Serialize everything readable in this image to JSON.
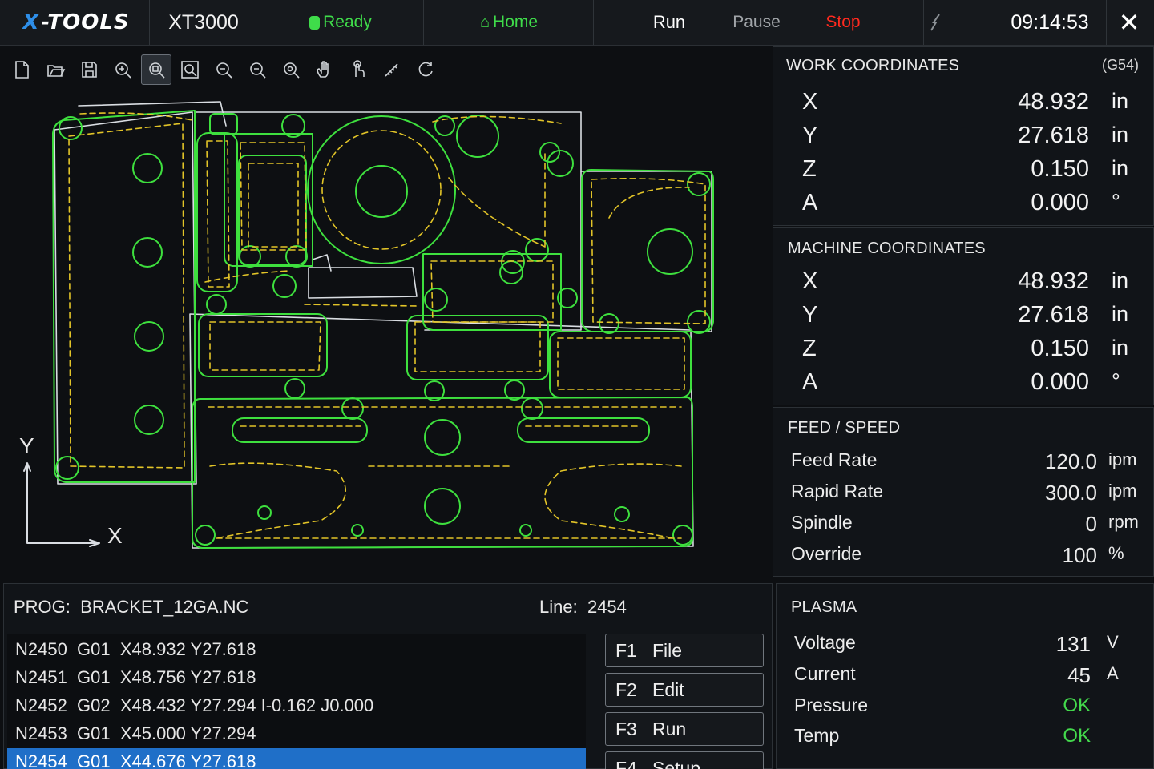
{
  "topbar": {
    "logo_x": "X",
    "logo_rest": "-TOOLS",
    "model": "XT3000",
    "status": "Ready",
    "home": "Home",
    "run": "Run",
    "pause": "Pause",
    "stop": "Stop",
    "time": "09:14:53",
    "close": "✕",
    "signal_icon": "signal-icon"
  },
  "toolbar": {
    "tools": [
      "new-file-icon",
      "open-file-icon",
      "save-file-icon",
      "zoom-in-icon",
      "zoom-window-icon",
      "zoom-fit-icon",
      "zoom-extents-icon",
      "zoom-out-icon",
      "zoom-select-icon",
      "pan-hand-icon",
      "touch-icon",
      "measure-icon",
      "reset-view-icon"
    ],
    "active_index": 4
  },
  "canvas": {
    "axis_y": "Y",
    "axis_x": "X",
    "colors": {
      "part": "#3ee03e",
      "toolpath": "#e2c428",
      "outline": "#d9dde2"
    }
  },
  "work": {
    "title": "WORK COORDINATES",
    "offset": "(G54)",
    "rows": [
      {
        "axis": "X",
        "value": "48.932",
        "unit": "in"
      },
      {
        "axis": "Y",
        "value": "27.618",
        "unit": "in"
      },
      {
        "axis": "Z",
        "value": "0.150",
        "unit": "in"
      },
      {
        "axis": "A",
        "value": "0.000",
        "unit": "°"
      }
    ]
  },
  "machine": {
    "title": "MACHINE COORDINATES",
    "rows": [
      {
        "axis": "X",
        "value": "48.932",
        "unit": "in"
      },
      {
        "axis": "Y",
        "value": "27.618",
        "unit": "in"
      },
      {
        "axis": "Z",
        "value": "0.150",
        "unit": "in"
      },
      {
        "axis": "A",
        "value": "0.000",
        "unit": "°"
      }
    ]
  },
  "feed": {
    "title": "FEED / SPEED",
    "rows": [
      {
        "label": "Feed Rate",
        "value": "120.0",
        "unit": "ipm"
      },
      {
        "label": "Rapid Rate",
        "value": "300.0",
        "unit": "ipm"
      },
      {
        "label": "Spindle",
        "value": "0",
        "unit": "rpm"
      },
      {
        "label": "Override",
        "value": "100",
        "unit": "%"
      }
    ]
  },
  "plasma": {
    "title": "PLASMA",
    "rows": [
      {
        "label": "Voltage",
        "value": "131",
        "unit": "V"
      },
      {
        "label": "Current",
        "value": "45",
        "unit": "A"
      },
      {
        "label": "Pressure",
        "value": "OK",
        "unit": ""
      },
      {
        "label": "Temp",
        "value": "OK",
        "unit": ""
      }
    ]
  },
  "program": {
    "label": "PROG:",
    "name": "BRACKET_12GA.NC",
    "line_label": "Line:",
    "line": "2454",
    "lines": [
      "N2450  G01  X48.932 Y27.618",
      "N2451  G01  X48.756 Y27.618",
      "N2452  G02  X48.432 Y27.294 I-0.162 J0.000",
      "N2453  G01  X45.000 Y27.294",
      "N2454  G01  X44.676 Y27.618"
    ],
    "selected_index": 4
  },
  "fkeys": [
    {
      "key": "F1",
      "label": "File"
    },
    {
      "key": "F2",
      "label": "Edit"
    },
    {
      "key": "F3",
      "label": "Run"
    },
    {
      "key": "F4",
      "label": "Setup"
    }
  ],
  "colors": {
    "accent": "#1f6fc8",
    "ok": "#43d94c",
    "stop": "#ff2a1f"
  }
}
